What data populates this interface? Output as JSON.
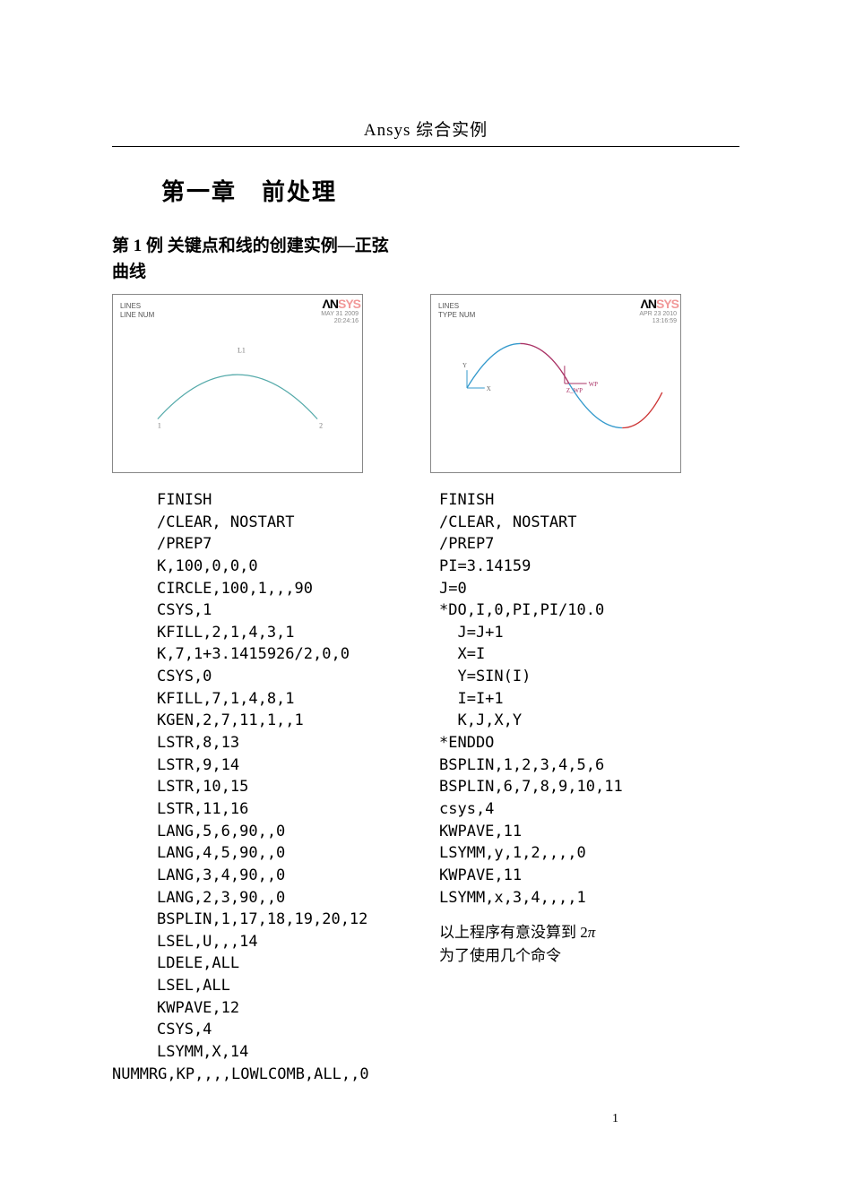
{
  "header": {
    "running_head": "Ansys 综合实例"
  },
  "chapter": {
    "title": "第一章　前处理"
  },
  "example": {
    "title_line": "第 1 例  关键点和线的创建实例—正弦曲线"
  },
  "figure1": {
    "label1": "LINES",
    "label2": "LINE NUM",
    "logo_black": "ΛN",
    "logo_red": "SYS",
    "meta1": "MAY 31 2009",
    "meta2": "20:24:16",
    "pt_left": "1",
    "pt_right": "2",
    "pt_top": "L1"
  },
  "figure2": {
    "label1": "LINES",
    "label2": "TYPE NUM",
    "logo_black": "ΛN",
    "logo_red": "SYS",
    "meta1": "APR 23 2010",
    "meta2": "13:16:59",
    "axis_x": "X",
    "axis_y": "Y",
    "axis_z": "Z_WP"
  },
  "code_left": [
    "FINISH",
    "/CLEAR, NOSTART",
    "/PREP7",
    "K,100,0,0,0",
    "CIRCLE,100,1,,,90",
    "CSYS,1",
    "KFILL,2,1,4,3,1",
    "K,7,1+3.1415926/2,0,0",
    "CSYS,0",
    "KFILL,7,1,4,8,1",
    "KGEN,2,7,11,1,,1",
    "LSTR,8,13",
    "LSTR,9,14",
    "LSTR,10,15",
    "LSTR,11,16",
    "LANG,5,6,90,,0",
    "LANG,4,5,90,,0",
    "LANG,3,4,90,,0",
    "LANG,2,3,90,,0",
    "BSPLIN,1,17,18,19,20,12",
    "LSEL,U,,,14",
    "LDELE,ALL",
    "LSEL,ALL",
    "KWPAVE,12",
    "CSYS,4",
    "LSYMM,X,14",
    "NUMMRG,KP,,,,LOWLCOMB,ALL,,0"
  ],
  "code_right": [
    "FINISH",
    "/CLEAR, NOSTART",
    "/PREP7",
    "PI=3.14159",
    "J=0",
    "*DO,I,0,PI,PI/10.0",
    "  J=J+1",
    "  X=I",
    "  Y=SIN(I)",
    "  I=I+1",
    "  K,J,X,Y",
    "*ENDDO",
    "BSPLIN,1,2,3,4,5,6",
    "BSPLIN,6,7,8,9,10,11",
    "csys,4",
    "KWPAVE,11",
    "LSYMM,y,1,2,,,,0",
    "KWPAVE,11",
    "LSYMM,x,3,4,,,,1"
  ],
  "note": {
    "line1_a": "以上程序有意没算到 2",
    "line1_pi": "π",
    "line2": "为了使用几个命令"
  },
  "page_number": "1"
}
